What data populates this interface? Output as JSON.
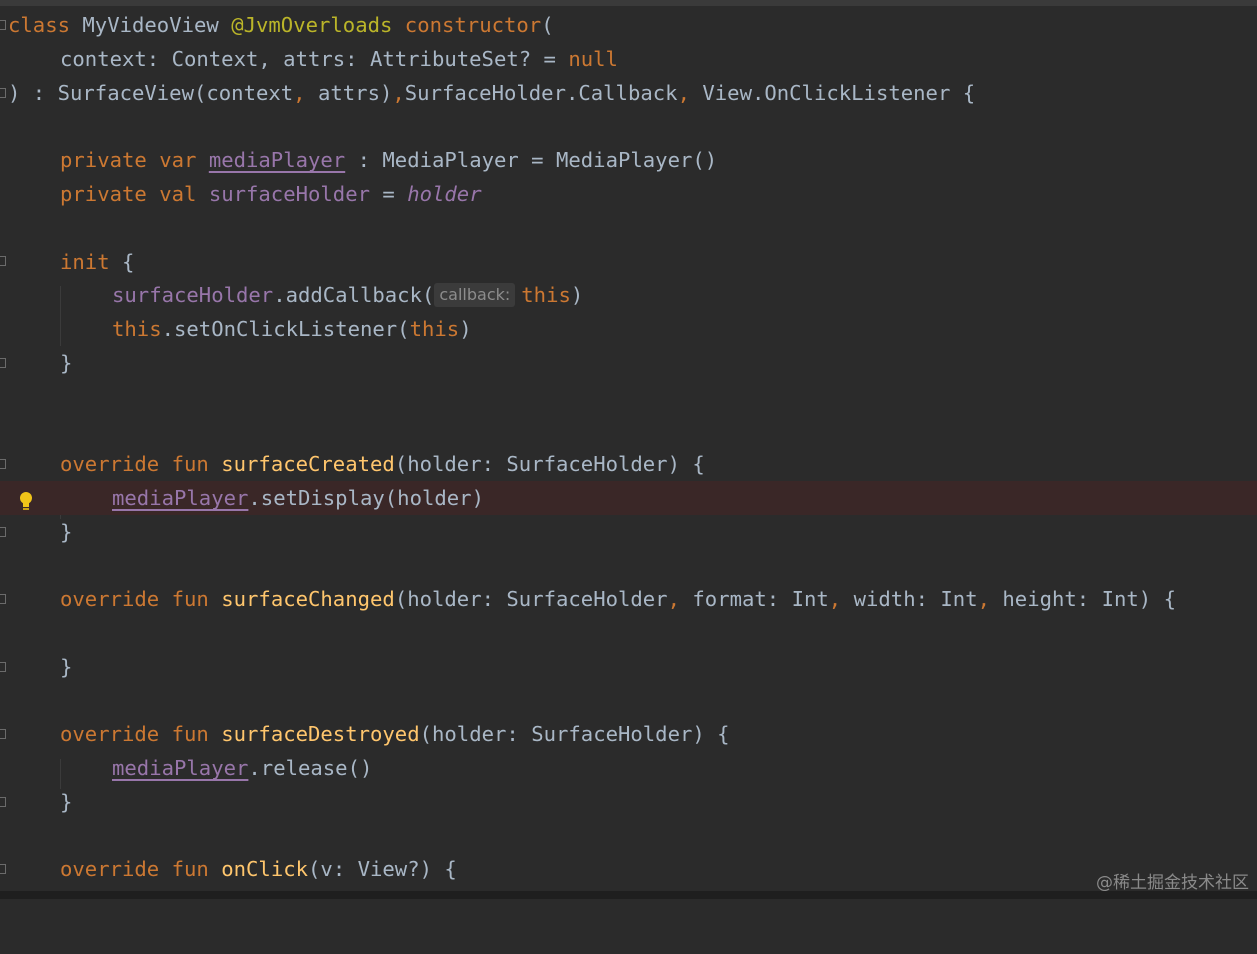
{
  "code": {
    "l1": {
      "kw_class": "class",
      "name": "MyVideoView",
      "annotation": "@JvmOverloads",
      "kw_constructor": "constructor",
      "open_paren": "("
    },
    "l2": {
      "p1": "context: Context, attrs: AttributeSet? = ",
      "kw_null": "null"
    },
    "l3": {
      "a": ") : SurfaceView(context",
      "comma1": ",",
      "b": " attrs)",
      "comma2": ",",
      "c": "SurfaceHolder.Callback",
      "comma3": ",",
      "d": " View.OnClickListener {"
    },
    "l5": {
      "kw_private": "private",
      "kw_var": "var",
      "prop": "mediaPlayer",
      "rest": " : MediaPlayer = MediaPlayer()"
    },
    "l6": {
      "kw_private": "private",
      "kw_val": "val",
      "prop": "surfaceHolder",
      "eq": " = ",
      "holder": "holder"
    },
    "l8": {
      "kw_init": "init",
      "brace": " {"
    },
    "l9": {
      "prop": "surfaceHolder",
      "call": ".addCallback(",
      "hint": "callback:",
      "kw_this": "this",
      "close": ")"
    },
    "l10": {
      "kw_this": "this",
      "call": ".setOnClickListener(",
      "kw_this2": "this",
      "close": ")"
    },
    "l11": {
      "brace": "}"
    },
    "l14": {
      "kw_override": "override",
      "kw_fun": "fun",
      "fn": "surfaceCreated",
      "params": "(holder: SurfaceHolder) {"
    },
    "l15": {
      "prop": "mediaPlayer",
      "call": ".setDisplay(holder)"
    },
    "l16": {
      "brace": "}"
    },
    "l18": {
      "kw_override": "override",
      "kw_fun": "fun",
      "fn": "surfaceChanged",
      "p1": "(holder: SurfaceHolder",
      "c1": ",",
      "p2": " format: Int",
      "c2": ",",
      "p3": " width: Int",
      "c3": ",",
      "p4": " height: Int) {"
    },
    "l20": {
      "brace": "}"
    },
    "l22": {
      "kw_override": "override",
      "kw_fun": "fun",
      "fn": "surfaceDestroyed",
      "params": "(holder: SurfaceHolder) {"
    },
    "l23": {
      "prop": "mediaPlayer",
      "call": ".release()"
    },
    "l24": {
      "brace": "}"
    },
    "l26": {
      "kw_override": "override",
      "kw_fun": "fun",
      "fn": "onClick",
      "params": "(v: View?) {"
    }
  },
  "watermark": "@稀土掘金技术社区",
  "colors": {
    "background": "#2b2b2b",
    "keyword": "#cc7832",
    "annotation": "#bbb529",
    "function": "#ffc66d",
    "property": "#9876aa",
    "text": "#a9b7c6",
    "highlight_line": "#3a2727",
    "bulb": "#f0c419"
  },
  "icons": {
    "gutter": "fold-marker-icon",
    "intention": "lightbulb-icon"
  }
}
